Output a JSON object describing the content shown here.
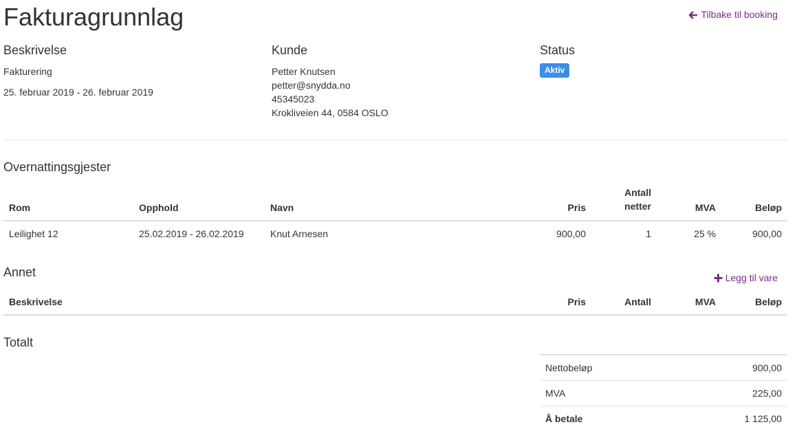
{
  "page": {
    "title": "Fakturagrunnlag",
    "back_link": "Tilbake til booking"
  },
  "colors": {
    "link": "#7b2a8b",
    "badge": "#3b8ee8"
  },
  "description": {
    "heading": "Beskrivelse",
    "text": "Fakturering",
    "period": "25. februar 2019 - 26. februar 2019"
  },
  "customer": {
    "heading": "Kunde",
    "name": "Petter Knutsen",
    "email": "petter@snydda.no",
    "phone": "45345023",
    "address": "Krokliveien 44, 0584 OSLO"
  },
  "status": {
    "heading": "Status",
    "value": "Aktiv"
  },
  "guests": {
    "heading": "Overnattingsgjester",
    "columns": {
      "room": "Rom",
      "stay": "Opphold",
      "name": "Navn",
      "price": "Pris",
      "nights_1": "Antall",
      "nights_2": "netter",
      "vat": "MVA",
      "amount": "Beløp"
    },
    "rows": [
      {
        "room": "Leilighet 12",
        "stay": "25.02.2019 - 26.02.2019",
        "name": "Knut Arnesen",
        "price": "900,00",
        "nights": "1",
        "vat": "25 %",
        "amount": "900,00"
      }
    ]
  },
  "other": {
    "heading": "Annet",
    "add_label": "Legg til vare",
    "columns": {
      "description": "Beskrivelse",
      "price": "Pris",
      "qty": "Antall",
      "vat": "MVA",
      "amount": "Beløp"
    }
  },
  "totals": {
    "heading": "Totalt",
    "rows": [
      {
        "label": "Nettobeløp",
        "value": "900,00"
      },
      {
        "label": "MVA",
        "value": "225,00"
      },
      {
        "label": "Å betale",
        "value": "1 125,00"
      }
    ]
  }
}
